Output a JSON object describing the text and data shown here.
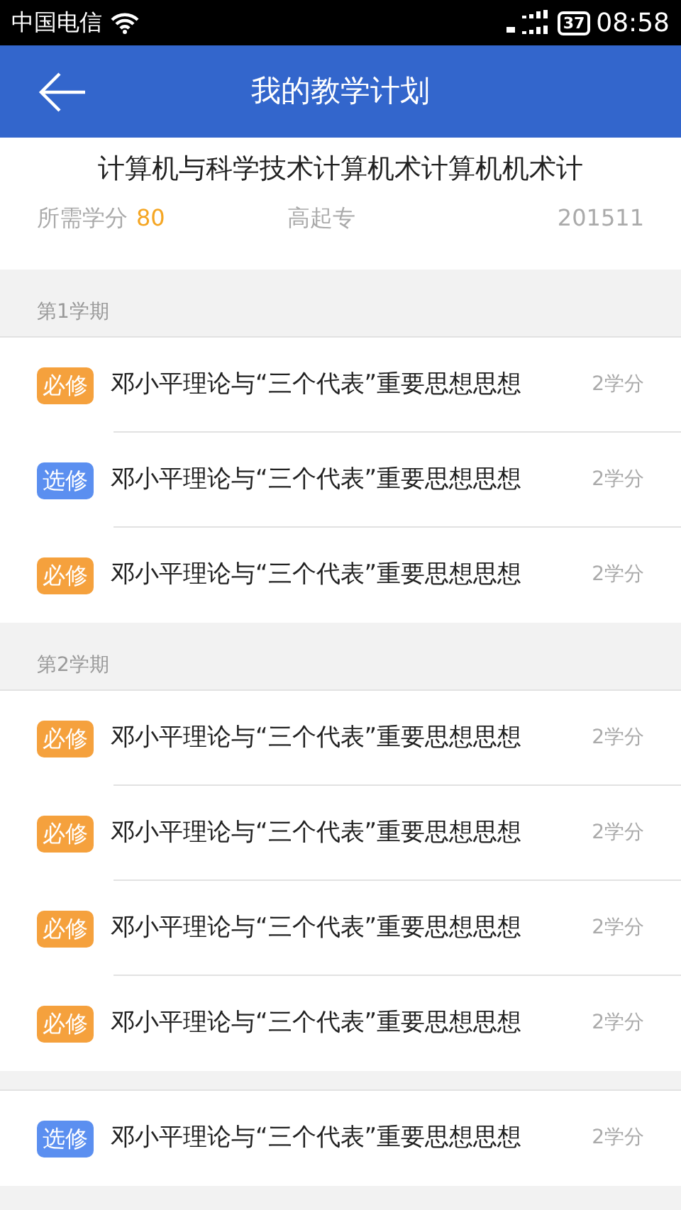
{
  "status_bar": {
    "carrier": "中国电信",
    "battery": "37",
    "time": "08:58"
  },
  "header": {
    "title": "我的教学计划"
  },
  "plan": {
    "name": "计算机与科学技术计算机术计算机机术计",
    "credits_label": "所需学分",
    "credits": "80",
    "level": "高起专",
    "batch": "201511"
  },
  "groups": [
    {
      "term": "第1学期",
      "courses": [
        {
          "kind": "required",
          "tag": "必修",
          "name": "邓小平理论与“三个代表”重要思想思想",
          "credits": "2学分"
        },
        {
          "kind": "elective",
          "tag": "选修",
          "name": "邓小平理论与“三个代表”重要思想思想",
          "credits": "2学分"
        },
        {
          "kind": "required",
          "tag": "必修",
          "name": "邓小平理论与“三个代表”重要思想思想",
          "credits": "2学分"
        }
      ]
    },
    {
      "term": "第2学期",
      "courses": [
        {
          "kind": "required",
          "tag": "必修",
          "name": "邓小平理论与“三个代表”重要思想思想",
          "credits": "2学分"
        },
        {
          "kind": "required",
          "tag": "必修",
          "name": "邓小平理论与“三个代表”重要思想思想",
          "credits": "2学分"
        },
        {
          "kind": "required",
          "tag": "必修",
          "name": "邓小平理论与“三个代表”重要思想思想",
          "credits": "2学分"
        },
        {
          "kind": "required",
          "tag": "必修",
          "name": "邓小平理论与“三个代表”重要思想思想",
          "credits": "2学分"
        }
      ]
    },
    {
      "courses": [
        {
          "kind": "elective",
          "tag": "选修",
          "name": "邓小平理论与“三个代表”重要思想思想",
          "credits": "2学分"
        }
      ]
    }
  ]
}
